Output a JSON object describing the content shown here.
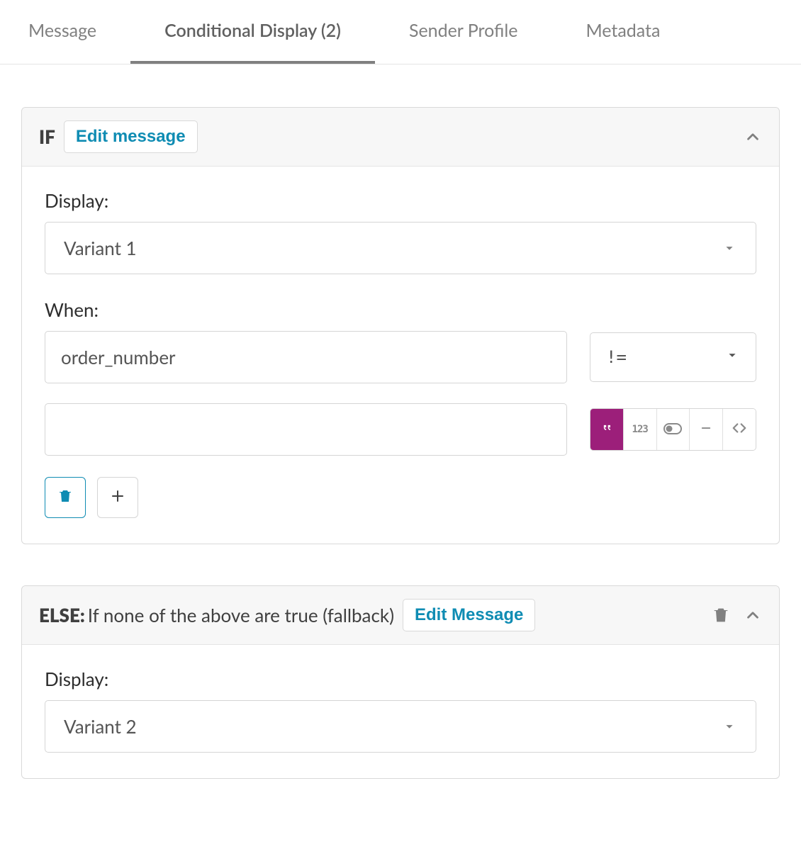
{
  "tabs": {
    "message": "Message",
    "conditional": "Conditional Display (2)",
    "sender": "Sender Profile",
    "metadata": "Metadata"
  },
  "if_block": {
    "label": "IF",
    "edit_label": "Edit message",
    "display_label": "Display:",
    "display_value": "Variant 1",
    "when_label": "When:",
    "when_field": "order_number",
    "when_operator": "!=",
    "value": "",
    "type_number_label": "123"
  },
  "else_block": {
    "label": "ELSE:",
    "desc": "If none of the above are true (fallback)",
    "edit_label": "Edit Message",
    "display_label": "Display:",
    "display_value": "Variant 2"
  }
}
